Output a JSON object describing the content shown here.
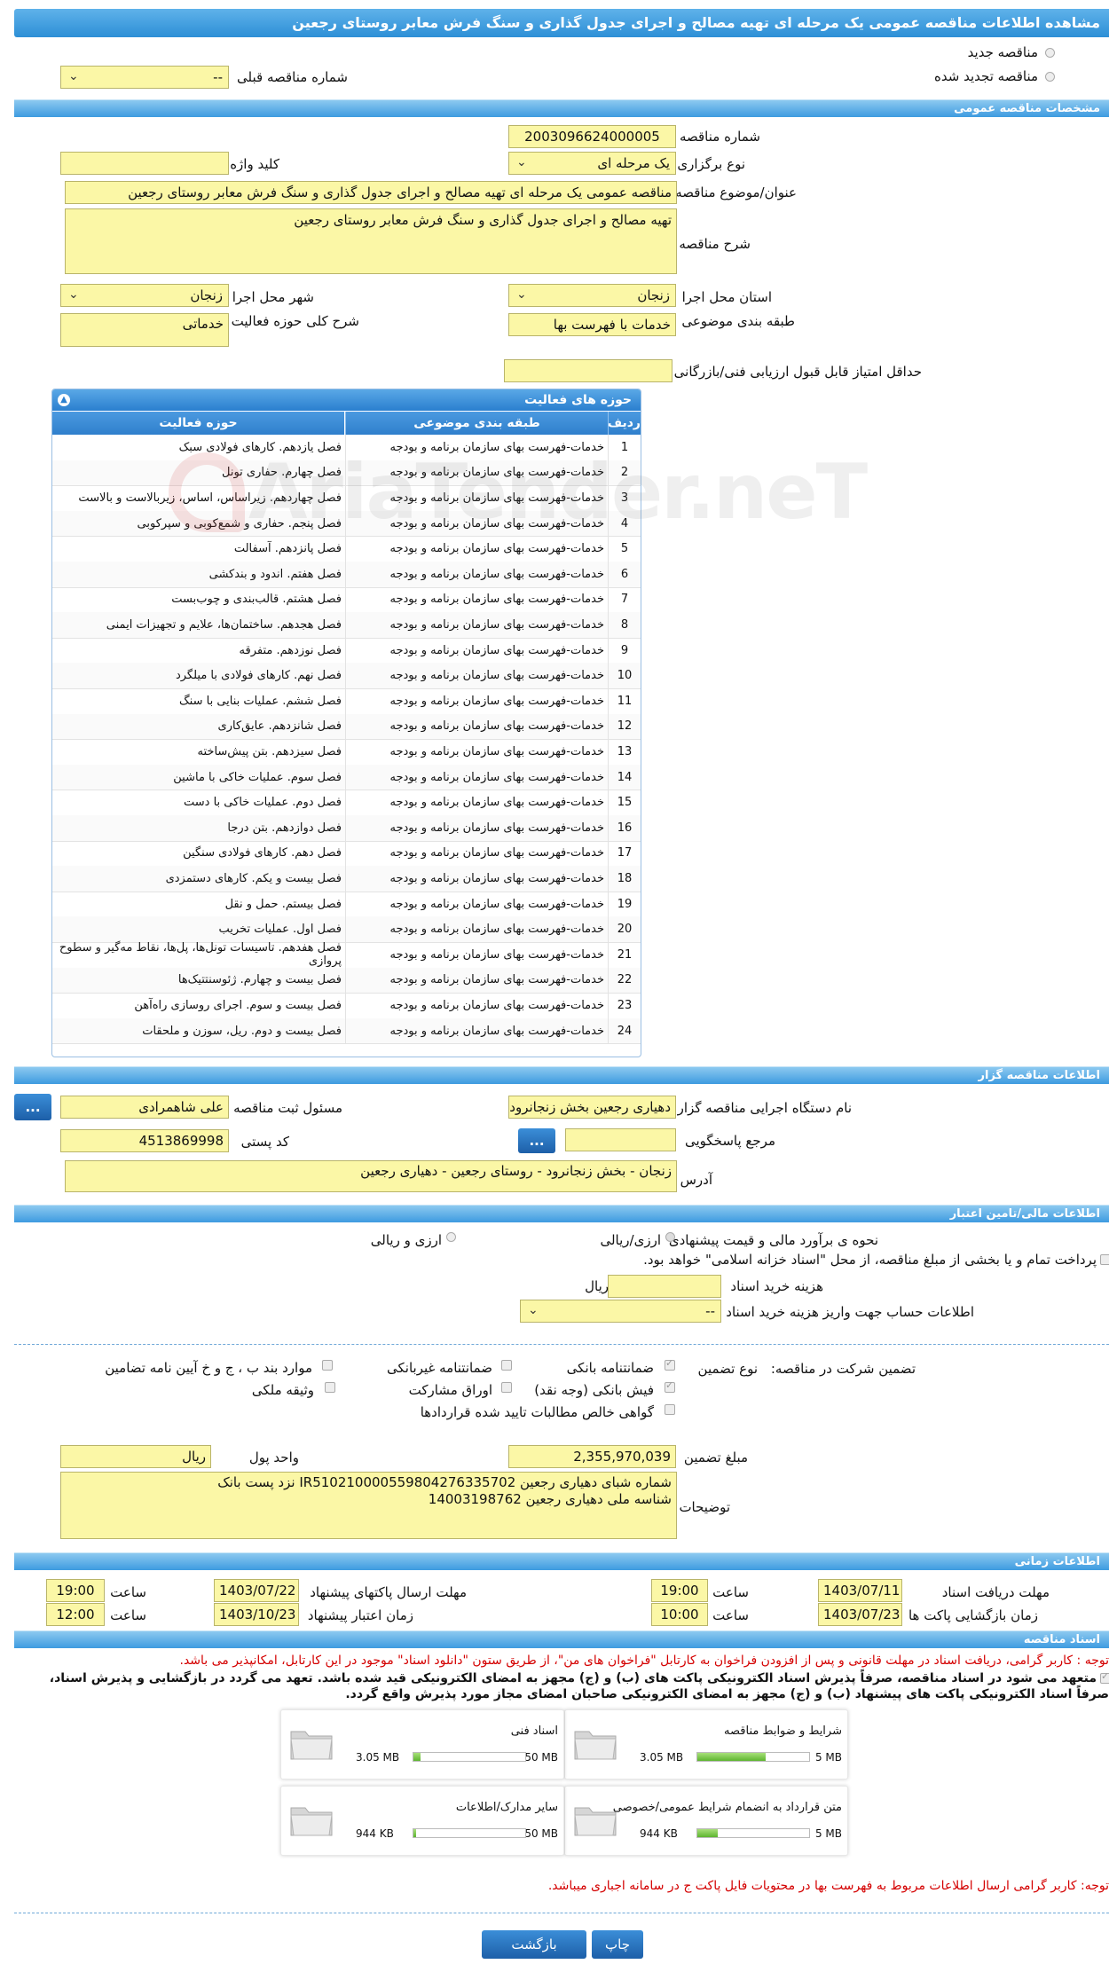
{
  "page_title": "مشاهده اطلاعات مناقصه عمومی یک مرحله ای تهیه مصالح و اجرای جدول گذاری و سنگ فرش معابر روستای رجعین",
  "top": {
    "radio_new": "مناقصه جدید",
    "radio_renewed": "مناقصه تجدید شده",
    "prev_tender_label": "شماره مناقصه قبلی",
    "prev_tender_value": "--"
  },
  "sections": {
    "general": "مشخصات مناقصه عمومی",
    "tenderer": "اطلاعات مناقصه گزار",
    "financial": "اطلاعات مالی/تامین اعتبار",
    "timing": "اطلاعات زمانی",
    "documents": "اسناد مناقصه"
  },
  "general": {
    "tender_no_label": "شماره مناقصه",
    "tender_no": "2003096624000005",
    "hold_type_label": "نوع برگزاری",
    "hold_type": "یک مرحله ای",
    "keyword_label": "کلید واژه",
    "keyword": "",
    "subject_label": "عنوان/موضوع مناقصه",
    "subject": "مناقصه عمومی یک مرحله ای تهیه مصالح و اجرای  جدول گذاری و سنگ فرش معابر روستای رجعین",
    "desc_label": "شرح مناقصه",
    "desc": "تهیه مصالح و اجرای  جدول گذاری و سنگ فرش معابر روستای رجعین",
    "province_label": "استان محل اجرا",
    "province": "زنجان",
    "city_label": "شهر محل اجرا",
    "city": "زنجان",
    "category_label": "طبقه بندی موضوعی",
    "category": "خدمات با فهرست بها",
    "activity_desc_label": "شرح کلی حوزه فعالیت",
    "activity_desc": "خدماتی",
    "min_score_label": "حداقل امتیاز قابل قبول ارزیابی فنی/بازرگانی",
    "min_score": ""
  },
  "activities": {
    "panel_title": "حوزه های فعالیت",
    "col_row": "ردیف",
    "col_category": "طبقه بندی موضوعی",
    "col_activity": "حوزه فعالیت",
    "rows": [
      {
        "no": "1",
        "cat": "خدمات-فهرست بهای سازمان برنامه و بودجه",
        "act": "فصل یازدهم. کارهای فولادی سبک"
      },
      {
        "no": "2",
        "cat": "خدمات-فهرست بهای سازمان برنامه و بودجه",
        "act": "فصل چهارم. حفاری تونل"
      },
      {
        "no": "3",
        "cat": "خدمات-فهرست بهای سازمان برنامه و بودجه",
        "act": "فصل چهاردهم. زیراساس، اساس، زیربالاست  و بالاست"
      },
      {
        "no": "4",
        "cat": "خدمات-فهرست بهای سازمان برنامه و بودجه",
        "act": "فصل پنجم. حفاری و شمع‌کوبی و سپرکوبی"
      },
      {
        "no": "5",
        "cat": "خدمات-فهرست بهای سازمان برنامه و بودجه",
        "act": "فصل پانزدهم. آسفالت"
      },
      {
        "no": "6",
        "cat": "خدمات-فهرست بهای سازمان برنامه و بودجه",
        "act": "فصل هفتم. اندود و بندکشی"
      },
      {
        "no": "7",
        "cat": "خدمات-فهرست بهای سازمان برنامه و بودجه",
        "act": "فصل هشتم. قالب‌بندی و چوب‌بست"
      },
      {
        "no": "8",
        "cat": "خدمات-فهرست بهای سازمان برنامه و بودجه",
        "act": "فصل هجدهم. ساختمان‌ها، علایم و تجهیزات ایمنی"
      },
      {
        "no": "9",
        "cat": "خدمات-فهرست بهای سازمان برنامه و بودجه",
        "act": "فصل نوزدهم. متفرقه"
      },
      {
        "no": "10",
        "cat": "خدمات-فهرست بهای سازمان برنامه و بودجه",
        "act": "فصل نهم. کارهای فولادی با میلگرد"
      },
      {
        "no": "11",
        "cat": "خدمات-فهرست بهای سازمان برنامه و بودجه",
        "act": "فصل ششم. عملیات بنایی با سنگ"
      },
      {
        "no": "12",
        "cat": "خدمات-فهرست بهای سازمان برنامه و بودجه",
        "act": "فصل شانزدهم. عایق‌کاری"
      },
      {
        "no": "13",
        "cat": "خدمات-فهرست بهای سازمان برنامه و بودجه",
        "act": "فصل سیزدهم. بتن پیش‌ساخته"
      },
      {
        "no": "14",
        "cat": "خدمات-فهرست بهای سازمان برنامه و بودجه",
        "act": "فصل سوم. عملیات خاکی با ماشین"
      },
      {
        "no": "15",
        "cat": "خدمات-فهرست بهای سازمان برنامه و بودجه",
        "act": "فصل دوم. عملیات خاکی با دست"
      },
      {
        "no": "16",
        "cat": "خدمات-فهرست بهای سازمان برنامه و بودجه",
        "act": "فصل دوازدهم. بتن درجا"
      },
      {
        "no": "17",
        "cat": "خدمات-فهرست بهای سازمان برنامه و بودجه",
        "act": "فصل دهم. کارهای فولادی سنگین"
      },
      {
        "no": "18",
        "cat": "خدمات-فهرست بهای سازمان برنامه و بودجه",
        "act": "فصل بیست و یکم. کارهای دستمزدی"
      },
      {
        "no": "19",
        "cat": "خدمات-فهرست بهای سازمان برنامه و بودجه",
        "act": "فصل بیستم. حمل و نقل"
      },
      {
        "no": "20",
        "cat": "خدمات-فهرست بهای سازمان برنامه و بودجه",
        "act": "فصل اول. عملیات تخریب"
      },
      {
        "no": "21",
        "cat": "خدمات-فهرست بهای سازمان برنامه و بودجه",
        "act": "فصل هفدهم. تاسیسات تونل‌ها، پل‌ها، نقاط مه‌گیر و سطوح پروازی"
      },
      {
        "no": "22",
        "cat": "خدمات-فهرست بهای سازمان برنامه و بودجه",
        "act": "فصل بیست و چهارم. ژئوسنتتیک‌ها"
      },
      {
        "no": "23",
        "cat": "خدمات-فهرست بهای سازمان برنامه و بودجه",
        "act": "فصل بیست و سوم. اجرای روسازی راه‌آهن"
      },
      {
        "no": "24",
        "cat": "خدمات-فهرست بهای سازمان برنامه و بودجه",
        "act": "فصل بیست و دوم. ریل، سوزن و ملحقات"
      }
    ]
  },
  "tenderer": {
    "org_label": "نام دستگاه اجرایی مناقصه گزار",
    "org": "دهیاری رجعین بخش زنجانرود",
    "registrar_label": "مسئول ثبت مناقصه",
    "registrar": "علی شاهمرادی",
    "more_button": "...",
    "reference_label": "مرجع پاسخگویی",
    "reference": "",
    "postal_label": "کد پستی",
    "postal": "4513869998",
    "address_label": "آدرس",
    "address": "زنجان - بخش زنجانرود - روستای رجعین - دهیاری رجعین"
  },
  "financial": {
    "estimate_label": "نحوه ی برآورد مالی و قیمت پیشنهادی",
    "opt_rial": "ارزی/ریالی",
    "opt_fx": "ارزی و ریالی",
    "payment_note": "پرداخت تمام و یا بخشی از مبلغ مناقصه، از محل \"اسناد خزانه اسلامی\" خواهد بود.",
    "doc_cost_label": "هزینه خرید اسناد",
    "doc_cost": "",
    "doc_cost_unit": "ریال",
    "account_label": "اطلاعات حساب جهت واریز هزینه خرید اسناد",
    "account": "--",
    "guarantee_title": "تضمین شرکت در مناقصه:",
    "guarantee_type_label": "نوع تضمین",
    "g_bank": "ضمانتنامه بانکی",
    "g_nonbank": "ضمانتنامه غیربانکی",
    "g_clauses": "موارد بند ب ، ج و خ آیین نامه تضامین",
    "g_cash": "فیش بانکی (وجه نقد)",
    "g_bonds": "اوراق مشارکت",
    "g_property": "وثیقه ملکی",
    "g_claims": "گواهی خالص مطالبات تایید شده قراردادها",
    "amount_label": "مبلغ تضمین",
    "amount": "2,355,970,039",
    "currency_label": "واحد پول",
    "currency": "ریال",
    "notes_label": "توضیحات",
    "notes_line1": "شماره شبای دهیاری رجعین IR510210000559804276335702 نزد پست بانک",
    "notes_line2": "شناسه ملی دهیاری رجعین 14003198762"
  },
  "timing": {
    "doc_receive_label": "مهلت دریافت اسناد",
    "doc_receive_date": "1403/07/11",
    "doc_receive_time": "19:00",
    "send_label": "مهلت ارسال پاکتهای پیشنهاد",
    "send_date": "1403/07/22",
    "send_time": "19:00",
    "open_label": "زمان بازگشایی پاکت ها",
    "open_date": "1403/07/23",
    "open_time": "10:00",
    "validity_label": "زمان اعتبار پیشنهاد",
    "validity_date": "1403/10/23",
    "validity_time": "12:00",
    "time_label": "ساعت"
  },
  "documents": {
    "note1": "توجه : کاربر گرامی، دریافت اسناد در مهلت قانونی و پس از افزودن فراخوان به کارتابل \"فراخوان های من\"، از طریق ستون \"دانلود اسناد\" موجود در این کارتابل، امکانپذیر می باشد.",
    "note2": "متعهد می شود در اسناد مناقصه، صرفاً پذیرش اسناد الکترونیکی پاکت های (ب) و (ج) مجهز به امضای الکترونیکی قید شده باشد. تعهد می گردد در بازگشایی و پذیرش اسناد،",
    "note3": "صرفاً اسناد الکترونیکی پاکت های پیشنهاد (ب) و (ج) مجهز به امضای الکترونیکی صاحبان امضای مجاز مورد پذیرش واقع گردد.",
    "files": [
      {
        "title": "شرایط و ضوابط مناقصه",
        "max": "5 MB",
        "current": "3.05 MB",
        "fill": 0.61
      },
      {
        "title": "اسناد فنی",
        "max": "50 MB",
        "current": "3.05 MB",
        "fill": 0.06
      },
      {
        "title": "متن قرارداد به انضمام شرایط عمومی/خصوصی",
        "max": "5 MB",
        "current": "944 KB",
        "fill": 0.18
      },
      {
        "title": "سایر مدارک/اطلاعات",
        "max": "50 MB",
        "current": "944 KB",
        "fill": 0.02
      }
    ],
    "note4": "توجه: کاربر گرامی ارسال اطلاعات مربوط به فهرست بها در محتویات فایل پاکت ج در سامانه اجباری میباشد."
  },
  "buttons": {
    "print": "چاپ",
    "back": "بازگشت"
  },
  "watermark": "AriaTender.neT"
}
